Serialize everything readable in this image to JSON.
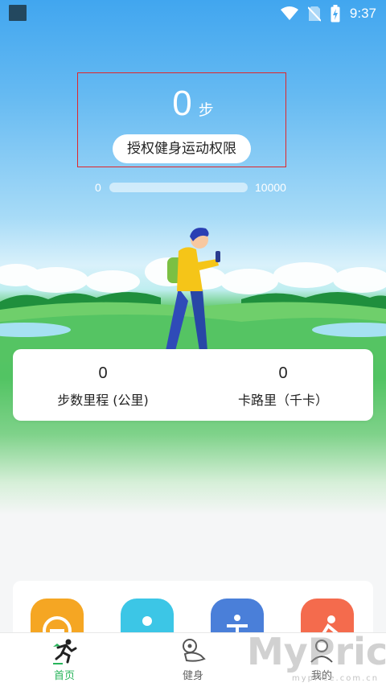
{
  "status_bar": {
    "time": "9:37",
    "icons": [
      "app-icon",
      "wifi-icon",
      "no-sim-icon",
      "battery-charging-icon"
    ]
  },
  "steps": {
    "value": "0",
    "unit": "步",
    "permission_button_label": "授权健身运动权限"
  },
  "goal": {
    "min_label": "0",
    "max_label": "10000",
    "progress_fraction": 0
  },
  "stats": {
    "distance": {
      "value": "0",
      "label": "步数里程 (公里)"
    },
    "calories": {
      "value": "0",
      "label": "卡路里（千卡）"
    }
  },
  "features": {
    "icons": [
      "timer-icon",
      "person-icon",
      "stretch-icon",
      "yoga-icon"
    ],
    "colors": [
      "#f5a623",
      "#3cc6e6",
      "#4a7fd9",
      "#f46b4d"
    ]
  },
  "bottom_nav": {
    "items": [
      {
        "label": "首页",
        "icon": "runner-icon",
        "active": true
      },
      {
        "label": "健身",
        "icon": "scale-icon",
        "active": false
      },
      {
        "label": "我的",
        "icon": "profile-icon",
        "active": false
      }
    ]
  },
  "colors": {
    "accent": "#27b45a",
    "highlight_border": "#e0262a",
    "sky": "#41a6ef",
    "grass": "#52c463"
  },
  "watermark": {
    "brand": "MyPrice",
    "url": "myprice.com.cn"
  }
}
